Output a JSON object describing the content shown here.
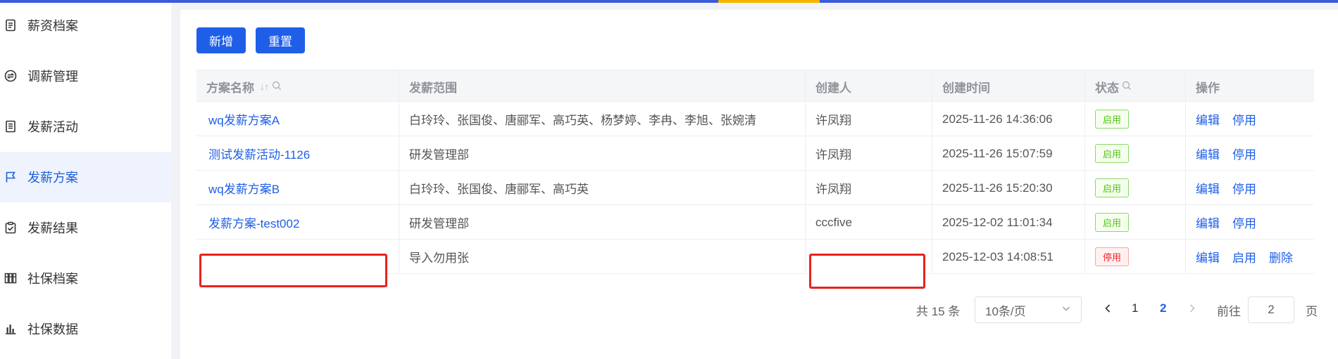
{
  "sidebar": {
    "items": [
      {
        "label": "薪资档案",
        "icon": "file-list-icon"
      },
      {
        "label": "调薪管理",
        "icon": "exchange-icon"
      },
      {
        "label": "发薪活动",
        "icon": "document-icon"
      },
      {
        "label": "发薪方案",
        "icon": "flag-icon",
        "active": true
      },
      {
        "label": "发薪结果",
        "icon": "clipboard-check-icon"
      },
      {
        "label": "社保档案",
        "icon": "columns-icon"
      },
      {
        "label": "社保数据",
        "icon": "bar-chart-icon"
      }
    ]
  },
  "toolbar": {
    "add_label": "新增",
    "reset_label": "重置"
  },
  "table": {
    "headers": {
      "name": "方案名称",
      "scope": "发薪范围",
      "creator": "创建人",
      "created_at": "创建时间",
      "status": "状态",
      "actions": "操作"
    },
    "rows": [
      {
        "name": "wq发薪方案A",
        "scope": "白玲玲、张国俊、唐郦军、高巧英、杨梦婷、李冉、李旭、张婉清",
        "creator": "许凤翔",
        "created_at": "2025-11-26 14:36:06",
        "status": "启用",
        "actions": [
          "编辑",
          "停用"
        ]
      },
      {
        "name": "测试发薪活动-1126",
        "scope": "研发管理部",
        "creator": "许凤翔",
        "created_at": "2025-11-26 15:07:59",
        "status": "启用",
        "actions": [
          "编辑",
          "停用"
        ]
      },
      {
        "name": "wq发薪方案B",
        "scope": "白玲玲、张国俊、唐郦军、高巧英",
        "creator": "许凤翔",
        "created_at": "2025-11-26 15:20:30",
        "status": "启用",
        "actions": [
          "编辑",
          "停用"
        ]
      },
      {
        "name": "发薪方案-test002",
        "scope": "研发管理部",
        "creator": "cccfive",
        "created_at": "2025-12-02 11:01:34",
        "status": "启用",
        "actions": [
          "编辑",
          "停用"
        ]
      },
      {
        "name": "",
        "scope": "导入勿用张",
        "creator": "",
        "created_at": "2025-12-03 14:08:51",
        "status": "停用",
        "actions": [
          "编辑",
          "启用",
          "删除"
        ]
      }
    ]
  },
  "pagination": {
    "total_label": "共 15 条",
    "page_size": "10条/页",
    "pages": [
      "1",
      "2"
    ],
    "current_page": "2",
    "jump_prefix": "前往",
    "jump_value": "2",
    "jump_suffix": "页"
  },
  "colors": {
    "primary": "#1f5fe8",
    "topbar": "#3b5bdb",
    "topbar_accent": "#f5b400",
    "redaction": "#e8221c",
    "status_on": "#52c41a",
    "status_off": "#f5222d"
  }
}
